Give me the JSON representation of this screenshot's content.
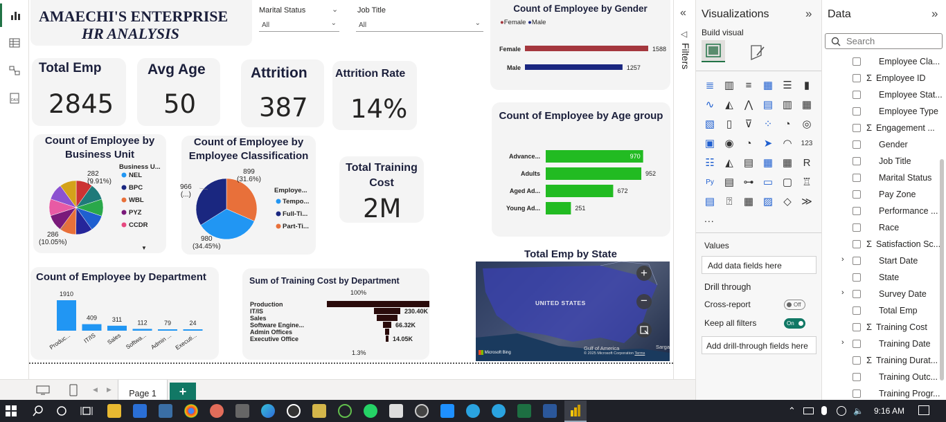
{
  "report": {
    "company": "AMAECHI'S ENTERPRISE",
    "subtitle": "HR ANALYSIS"
  },
  "slicers": {
    "marital_status": {
      "label": "Marital Status",
      "value": "All"
    },
    "job_title": {
      "label": "Job Title",
      "value": "All"
    }
  },
  "kpis": {
    "total_emp": {
      "title": "Total Emp",
      "value": "2845"
    },
    "avg_age": {
      "title": "Avg Age",
      "value": "50"
    },
    "attrition": {
      "title": "Attrition",
      "value": "387"
    },
    "attrition_rate": {
      "title": "Attrition Rate",
      "value": "14%"
    },
    "training_cost": {
      "title": "Total Training Cost",
      "value": "2M"
    }
  },
  "chart_data": [
    {
      "type": "bar",
      "orientation": "horizontal",
      "title": "Count of Employee by Gender",
      "legend": [
        "Female",
        "Male"
      ],
      "categories": [
        "Female",
        "Male"
      ],
      "values": [
        1588,
        1257
      ],
      "colors": [
        "#a4373e",
        "#1a2780"
      ]
    },
    {
      "type": "bar",
      "orientation": "horizontal",
      "title": "Count of Employee by Age group",
      "categories": [
        "Advance...",
        "Adults",
        "Aged Ad...",
        "Young Ad..."
      ],
      "values": [
        970,
        952,
        672,
        251
      ],
      "color": "#22bb22"
    },
    {
      "type": "pie",
      "title": "Count of Employee by Business Unit",
      "legend_title": "Business U...",
      "legend": [
        "NEL",
        "BPC",
        "WBL",
        "PYZ",
        "CCDR"
      ],
      "labels": [
        {
          "value": "282",
          "pct": "(9.91%)"
        },
        {
          "value": "286",
          "pct": "(10.05%)"
        }
      ]
    },
    {
      "type": "pie",
      "title": "Count of Employee by Employee Classification",
      "legend_title": "Employe...",
      "legend": [
        "Tempo...",
        "Full-Ti...",
        "Part-Ti..."
      ],
      "values": [
        980,
        966,
        899
      ],
      "labels": [
        {
          "value": "899",
          "pct": "(31.6%)"
        },
        {
          "value": "966",
          "pct": "(...)"
        },
        {
          "value": "980",
          "pct": "(34.45%)"
        }
      ],
      "colors": [
        "#2196f3",
        "#1a2780",
        "#e8703a"
      ]
    },
    {
      "type": "bar",
      "title": "Count of Employee by Department",
      "categories": [
        "Produc...",
        "IT/IS",
        "Sales",
        "Softwa...",
        "Admin ...",
        "Executi..."
      ],
      "values": [
        1910,
        409,
        311,
        112,
        79,
        24
      ],
      "color": "#2196f3"
    },
    {
      "type": "bar",
      "subtype": "funnel",
      "title": "Sum of Training Cost by Department",
      "categories": [
        "Production",
        "IT/IS",
        "Sales",
        "Software Engine...",
        "Admin Offices",
        "Executive Office"
      ],
      "values": [
        1200000,
        230400,
        180000,
        66320,
        25000,
        14050
      ],
      "labels": [
        "",
        "230.40K",
        "",
        "66.32K",
        "",
        "14.05K"
      ],
      "top_pct": "100%",
      "bottom_pct": "1.3%",
      "color": "#2a0b0b"
    }
  ],
  "map": {
    "title": "Total Emp by State",
    "label": "UNITED STATES",
    "gulf": "Gulf of America",
    "sargasso": "Sarga",
    "attribution": "Microsoft Bing",
    "copyright": "© 2025 Microsoft Corporation",
    "terms": "Terms"
  },
  "filters_label": "Filters",
  "viz_pane": {
    "title": "Visualizations",
    "build_visual": "Build visual",
    "values_label": "Values",
    "add_data": "Add data fields here",
    "drill_through": "Drill through",
    "cross_report": "Cross-report",
    "cross_report_state": "Off",
    "keep_filters": "Keep all filters",
    "keep_filters_state": "On",
    "add_drill": "Add drill-through fields here",
    "more": "..."
  },
  "data_pane": {
    "title": "Data",
    "search_placeholder": "Search",
    "fields": [
      {
        "name": "Employee Cla...",
        "sigma": false,
        "expand": false
      },
      {
        "name": "Employee ID",
        "sigma": true,
        "expand": false
      },
      {
        "name": "Employee Stat...",
        "sigma": false,
        "expand": false
      },
      {
        "name": "Employee Type",
        "sigma": false,
        "expand": false
      },
      {
        "name": "Engagement ...",
        "sigma": true,
        "expand": false
      },
      {
        "name": "Gender",
        "sigma": false,
        "expand": false
      },
      {
        "name": "Job Title",
        "sigma": false,
        "expand": false
      },
      {
        "name": "Marital Status",
        "sigma": false,
        "expand": false
      },
      {
        "name": "Pay Zone",
        "sigma": false,
        "expand": false
      },
      {
        "name": "Performance ...",
        "sigma": false,
        "expand": false
      },
      {
        "name": "Race",
        "sigma": false,
        "expand": false
      },
      {
        "name": "Satisfaction Sc...",
        "sigma": true,
        "expand": false
      },
      {
        "name": "Start Date",
        "sigma": false,
        "expand": true
      },
      {
        "name": "State",
        "sigma": false,
        "expand": false
      },
      {
        "name": "Survey Date",
        "sigma": false,
        "expand": true
      },
      {
        "name": "Total Emp",
        "sigma": false,
        "expand": false
      },
      {
        "name": "Training Cost",
        "sigma": true,
        "expand": false
      },
      {
        "name": "Training Date",
        "sigma": false,
        "expand": true
      },
      {
        "name": "Training Durat...",
        "sigma": true,
        "expand": false
      },
      {
        "name": "Training Outc...",
        "sigma": false,
        "expand": false
      },
      {
        "name": "Training Progr...",
        "sigma": false,
        "expand": false
      }
    ]
  },
  "page_tab": "Page 1",
  "add_page": "+",
  "taskbar": {
    "time": "9:16 AM"
  },
  "colors": {
    "accent": "#217346",
    "navy": "#1b1f3b",
    "green_bar": "#22bb22",
    "blue_bar": "#2196f3"
  }
}
